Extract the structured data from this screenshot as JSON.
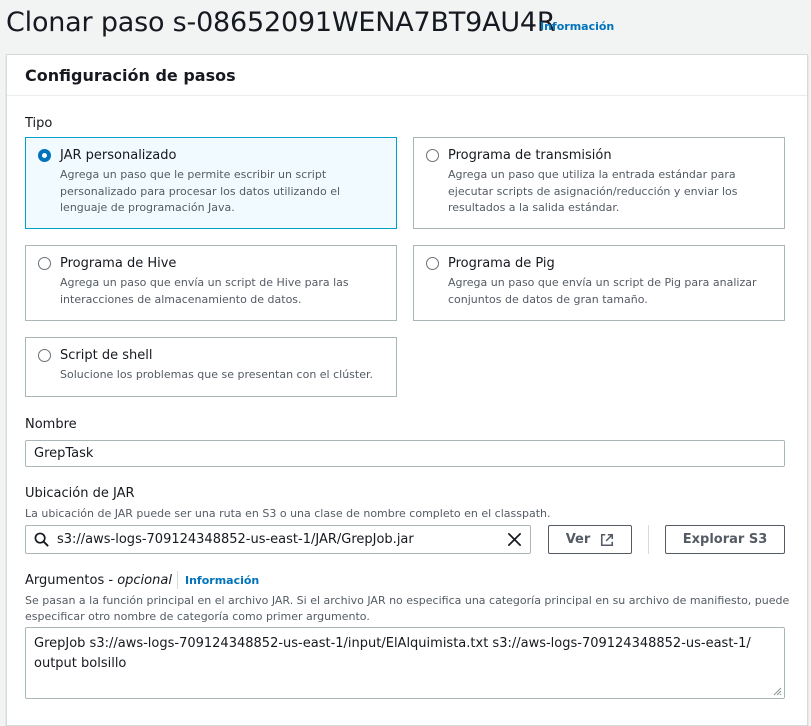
{
  "page": {
    "title": "Clonar paso s-08652091WENA7BT9AU4R",
    "info_link": "Información"
  },
  "panel": {
    "header": "Configuración de pasos"
  },
  "type_section": {
    "label": "Tipo",
    "options": [
      {
        "title": "JAR personalizado",
        "desc_lines": [
          "Agrega un paso que le permite escribir un script",
          "personalizado para procesar los datos utilizando el",
          "lenguaje de programación Java."
        ],
        "selected": true
      },
      {
        "title": "Programa de transmisión",
        "desc_lines": [
          "Agrega un paso que utiliza la entrada estándar para",
          "ejecutar scripts de asignación/reducción y enviar los",
          "resultados a la salida estándar."
        ],
        "selected": false
      },
      {
        "title": "Programa de Hive",
        "desc_lines": [
          "Agrega un paso que envía un script de Hive para las",
          "interacciones de almacenamiento de datos."
        ],
        "selected": false
      },
      {
        "title": "Programa de Pig",
        "desc_lines": [
          "Agrega un paso que envía un script de Pig para analizar",
          "conjuntos de datos de gran tamaño."
        ],
        "selected": false
      },
      {
        "title": "Script de shell",
        "desc_lines": [
          "Solucione los problemas que se presentan con el clúster."
        ],
        "selected": false
      }
    ]
  },
  "name_field": {
    "label": "Nombre",
    "value": "GrepTask"
  },
  "jar_field": {
    "label": "Ubicación de JAR",
    "description": "La ubicación de JAR puede ser una ruta en S3 o una clase de nombre completo en el classpath.",
    "value": "s3://aws-logs-709124348852-us-east-1/JAR/GrepJob.jar",
    "view_button": "Ver",
    "browse_button": "Explorar S3"
  },
  "args_field": {
    "label": "Argumentos",
    "label_suffix": "opcional",
    "info_link": "Información",
    "description_lines": [
      "Se pasan a la función principal en el archivo JAR. Si el archivo JAR no especifica una categoría principal en su archivo de manifiesto, puede",
      "especificar otro nombre de categoría como primer argumento."
    ],
    "value_lines": [
      "GrepJob s3://aws-logs-709124348852-us-east-1/input/ElAlquimista.txt s3://aws-logs-709124348852-us-east-1/",
      "output bolsillo"
    ]
  },
  "colors": {
    "accent": "#0073bb",
    "selected_border": "#00a1c9",
    "selected_bg": "#f1faff"
  }
}
